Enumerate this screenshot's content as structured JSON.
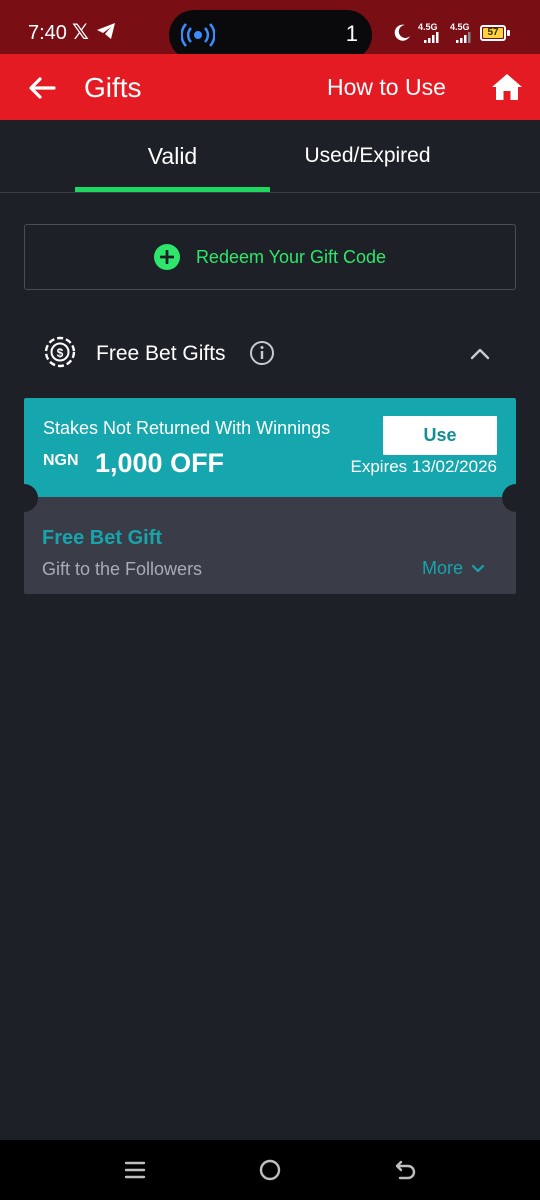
{
  "status_bar": {
    "time": "7:40",
    "notification_count": "1",
    "network_1": "4.5G",
    "network_2": "4.5G",
    "battery": "57"
  },
  "header": {
    "title": "Gifts",
    "how_to_use": "How to Use"
  },
  "tabs": [
    {
      "label": "Valid",
      "active": true
    },
    {
      "label": "Used/Expired",
      "active": false
    }
  ],
  "redeem": {
    "label": "Redeem Your Gift Code"
  },
  "section": {
    "title": "Free Bet Gifts"
  },
  "coupon": {
    "description": "Stakes Not Returned With Winnings",
    "currency": "NGN",
    "amount": "1,000 OFF",
    "use_label": "Use",
    "expiry": "Expires 13/02/2026",
    "name": "Free Bet Gift",
    "subtitle": "Gift to the Followers",
    "more_label": "More"
  },
  "colors": {
    "brand_red": "#e41b23",
    "status_bar": "#7a0e15",
    "background": "#1e2027",
    "accent_green": "#1ed760",
    "coupon_teal": "#16a6ad",
    "coupon_bottom": "#3a3d48"
  },
  "icons": {
    "back": "arrow-left-icon",
    "home": "home-icon",
    "plus": "plus-circle-icon",
    "coin": "dollar-coin-icon",
    "info": "info-icon",
    "collapse": "chevron-up-icon",
    "more": "chevron-down-icon"
  }
}
